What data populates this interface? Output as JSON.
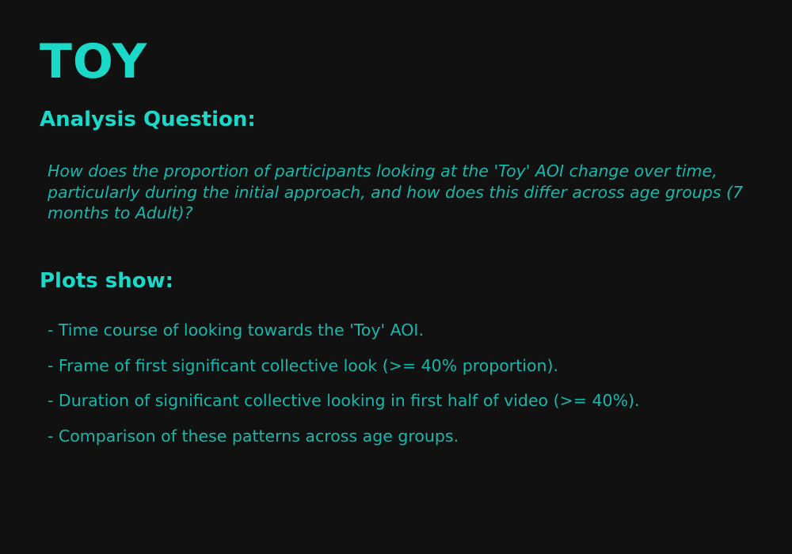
{
  "title": "TOY",
  "analysis": {
    "heading": "Analysis Question:",
    "question": "How does the proportion of participants looking at the 'Toy' AOI change over time, particularly during the initial approach, and how does this differ across age groups (7 months to Adult)?"
  },
  "plots": {
    "heading": "Plots show:",
    "items": [
      "- Time course of looking towards the 'Toy' AOI.",
      "- Frame of first significant collective look (>= 40% proportion).",
      "- Duration of significant collective looking in first half of video (>= 40%).",
      "- Comparison of these patterns across age groups."
    ]
  },
  "colors": {
    "background": "#111111",
    "heading": "#1ad9c8",
    "body_text": "#17b8ab"
  }
}
